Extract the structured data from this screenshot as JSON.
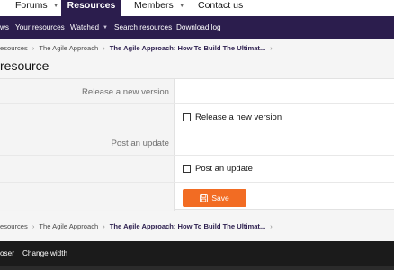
{
  "topnav": {
    "tabs": [
      {
        "label": "Forums",
        "caret": "▼"
      },
      {
        "label": "Resources"
      },
      {
        "label": "Members",
        "caret": "▼"
      },
      {
        "label": "Contact us"
      }
    ]
  },
  "subnav": {
    "items": [
      "ws",
      "Your resources",
      "Watched",
      "Search resources",
      "Download log"
    ],
    "watched_caret": "▼"
  },
  "breadcrumb": {
    "items": [
      "esources",
      "The Agile Approach",
      "The Agile Approach: How To Build The Ultimat..."
    ],
    "separator": "›"
  },
  "page": {
    "title": "resource"
  },
  "form": {
    "release_section_label": "Release a new version",
    "release_checkbox_label": "Release a new version",
    "update_section_label": "Post an update",
    "update_checkbox_label": "Post an update",
    "save_label": "Save"
  },
  "footer": {
    "links": [
      "oser",
      "Change width"
    ]
  },
  "colors": {
    "brand": "#2b1d4d",
    "accent": "#f26c23",
    "footer": "#1b1b1b"
  }
}
